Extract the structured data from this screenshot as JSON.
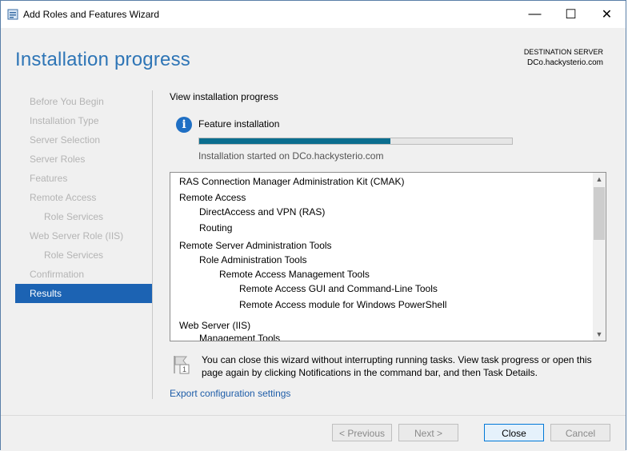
{
  "window": {
    "title": "Add Roles and Features Wizard",
    "minimize_glyph": "—",
    "maximize_glyph": "☐",
    "close_glyph": "✕"
  },
  "header": {
    "page_title": "Installation progress",
    "destination_label": "DESTINATION SERVER",
    "destination_server": "DCo.hackysterio.com"
  },
  "sidebar": {
    "items": [
      {
        "label": "Before You Begin",
        "indent": 0,
        "active": false
      },
      {
        "label": "Installation Type",
        "indent": 0,
        "active": false
      },
      {
        "label": "Server Selection",
        "indent": 0,
        "active": false
      },
      {
        "label": "Server Roles",
        "indent": 0,
        "active": false
      },
      {
        "label": "Features",
        "indent": 0,
        "active": false
      },
      {
        "label": "Remote Access",
        "indent": 0,
        "active": false
      },
      {
        "label": "Role Services",
        "indent": 1,
        "active": false
      },
      {
        "label": "Web Server Role (IIS)",
        "indent": 0,
        "active": false
      },
      {
        "label": "Role Services",
        "indent": 1,
        "active": false
      },
      {
        "label": "Confirmation",
        "indent": 0,
        "active": false
      },
      {
        "label": "Results",
        "indent": 0,
        "active": true
      }
    ]
  },
  "main": {
    "view_label": "View installation progress",
    "info_glyph": "i",
    "feature_label": "Feature installation",
    "progress_fraction": 0.61,
    "progress_color": "#0b6e8f",
    "started_text": "Installation started on DCo.hackysterio.com",
    "list_lines": [
      {
        "text": "RAS Connection Manager Administration Kit (CMAK)",
        "level": 0
      },
      {
        "text": "Remote Access",
        "level": 0
      },
      {
        "text": "DirectAccess and VPN (RAS)",
        "level": 1
      },
      {
        "text": "Routing",
        "level": 1
      },
      {
        "text": "Remote Server Administration Tools",
        "level": 0
      },
      {
        "text": "Role Administration Tools",
        "level": 1
      },
      {
        "text": "Remote Access Management Tools",
        "level": 2
      },
      {
        "text": "Remote Access GUI and Command-Line Tools",
        "level": 3
      },
      {
        "text": "Remote Access module for Windows PowerShell",
        "level": 3
      },
      {
        "text": "Web Server (IIS)",
        "level": 0
      },
      {
        "text": "Management Tools",
        "level": 1
      }
    ],
    "scroll_up_glyph": "▲",
    "scroll_down_glyph": "▼",
    "note_text": "You can close this wizard without interrupting running tasks. View task progress or open this page again by clicking Notifications in the command bar, and then Task Details.",
    "note_badge": "1",
    "export_link": "Export configuration settings"
  },
  "footer": {
    "previous_label": "< Previous",
    "next_label": "Next >",
    "close_label": "Close",
    "cancel_label": "Cancel"
  },
  "accent_color": "#1c63b3"
}
